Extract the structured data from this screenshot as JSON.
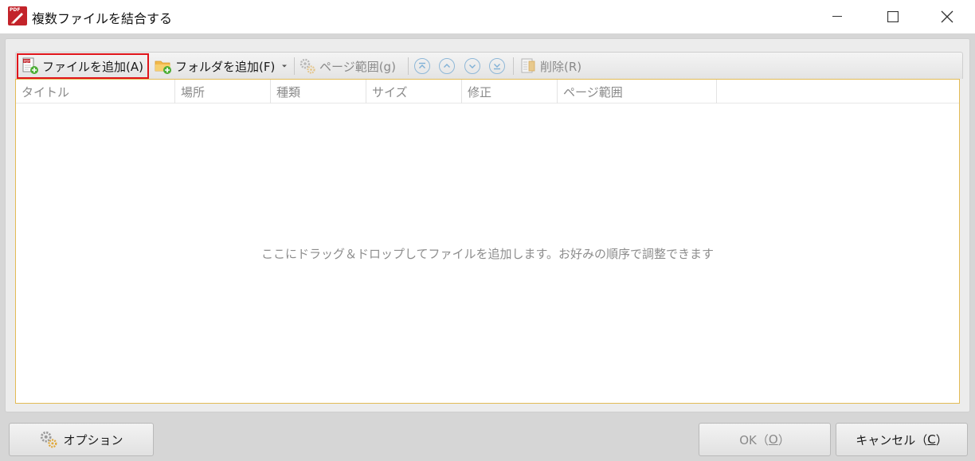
{
  "window": {
    "title": "複数ファイルを結合する",
    "app_icon": "pdf-app-icon"
  },
  "toolbar": {
    "add_file": "ファイルを追加(A)",
    "add_folder": "フォルダを追加(F)",
    "page_range": "ページ範囲(g)",
    "move_buttons": [
      "move-top-icon",
      "move-up-icon",
      "move-down-icon",
      "move-bottom-icon"
    ],
    "delete": "削除(R)"
  },
  "list": {
    "columns": [
      "タイトル",
      "場所",
      "種類",
      "サイズ",
      "修正",
      "ページ範囲"
    ],
    "empty_message": "ここにドラッグ＆ドロップしてファイルを追加します。お好みの順序で調整できます"
  },
  "buttons": {
    "options": "オプション",
    "ok_prefix": "OK（",
    "ok_key": "O",
    "ok_suffix": "）",
    "cancel_prefix": "キャンセル（",
    "cancel_key": "C",
    "cancel_suffix": "）"
  },
  "colors": {
    "highlight_border": "#e0151b",
    "list_border": "#e3bb55",
    "app_icon_red": "#c3232a"
  }
}
